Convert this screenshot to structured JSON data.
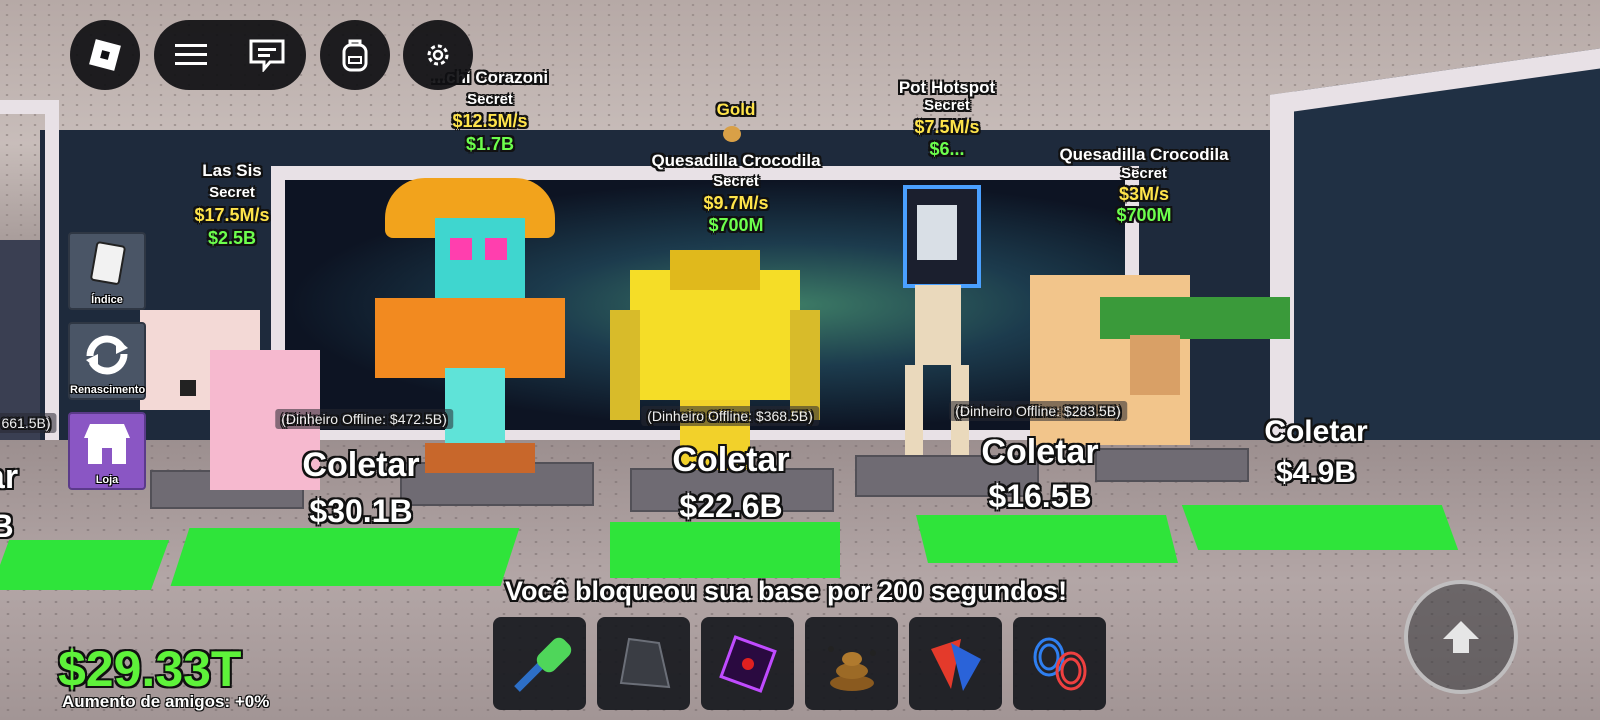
{
  "hud": {
    "money": "$29.33T",
    "friend_boost": "Aumento de amigos: +0%",
    "notice": "Você bloqueou sua base por 200 segundos!",
    "side_buttons": [
      {
        "label": "Índice",
        "icon": "book-icon"
      },
      {
        "label": "Renascimento",
        "icon": "rebirth-icon"
      },
      {
        "label": "Loja",
        "icon": "shop-icon"
      }
    ]
  },
  "hotbar": [
    {
      "icon": "green-gummy-bat-icon"
    },
    {
      "icon": "dark-cloak-icon"
    },
    {
      "icon": "purple-cube-icon"
    },
    {
      "icon": "poop-flies-icon"
    },
    {
      "icon": "red-blue-figure-icon"
    },
    {
      "icon": "coil-springs-icon"
    }
  ],
  "brainrots": [
    {
      "name": "Las Sis",
      "rarity": "Secret",
      "rate": "$17.5M/s",
      "price": "$2.5B"
    },
    {
      "name": "...chi Corazoni",
      "rarity": "Secret",
      "rate": "$12.5M/s",
      "price": "$1.7B"
    },
    {
      "mutation": "Gold",
      "name": "Quesadilla Crocodila",
      "rarity": "Secret",
      "rate": "$9.7M/s",
      "price": "$700M"
    },
    {
      "name": "Pot Hotspot",
      "rarity": "Secret",
      "rate": "$7.5M/s",
      "price": "$6..."
    },
    {
      "name": "Quesadilla Crocodila",
      "rarity": "Secret",
      "rate": "$3M/s",
      "price": "$700M"
    }
  ],
  "collectors": [
    {
      "offline": "661.5B)",
      "coletar": "ar",
      "amount": "B"
    },
    {
      "offline": "(Dinheiro Offline: $472.5B)",
      "coletar": "Coletar",
      "amount": "$30.1B"
    },
    {
      "offline": "(Dinheiro Offline: $368.5B)",
      "coletar": "Coletar",
      "amount": "$22.6B"
    },
    {
      "offline": "(Dinheiro Offline: $283.5B)",
      "coletar": "Coletar",
      "amount": "$16.5B"
    },
    {
      "offline": "",
      "coletar": "Coletar",
      "amount": "$4.9B"
    }
  ],
  "colors": {
    "money": "#5ef23a",
    "rate": "#ffe44a",
    "price": "#6dff4d",
    "pad": "#2fe43a"
  }
}
